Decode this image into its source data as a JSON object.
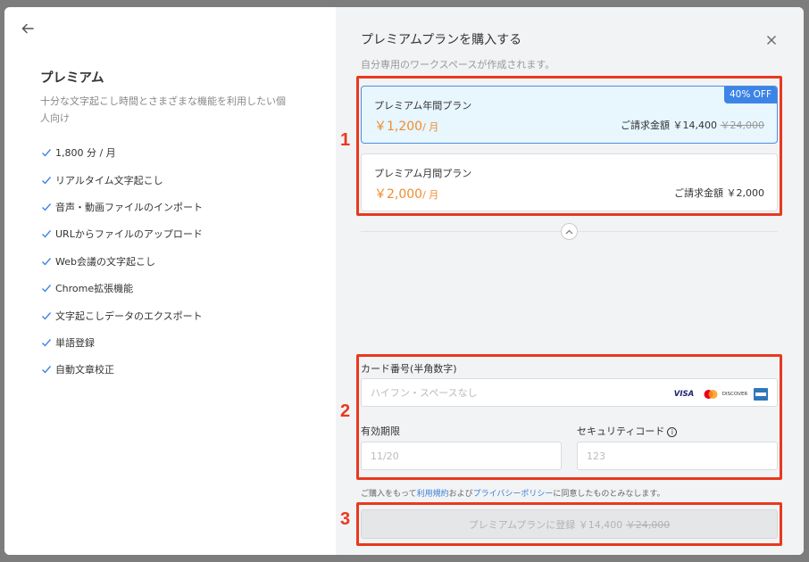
{
  "left": {
    "back_icon": "arrow-left-icon",
    "plan_title": "プレミアム",
    "plan_desc": "十分な文字起こし時間とさまざまな機能を利用したい個人向け",
    "features": [
      "1,800 分 / 月",
      "リアルタイム文字起こし",
      "音声・動画ファイルのインポート",
      "URLからファイルのアップロード",
      "Web会議の文字起こし",
      "Chrome拡張機能",
      "文字起こしデータのエクスポート",
      "単語登録",
      "自動文章校正"
    ]
  },
  "right": {
    "title": "プレミアムプランを購入する",
    "subtitle": "自分専用のワークスペースが作成されます。",
    "close_icon": "close-icon",
    "plans": [
      {
        "name": "プレミアム年間プラン",
        "price": "￥1,200",
        "per": "/ 月",
        "bill_label": "ご請求金額 ￥14,400",
        "bill_strike": "￥24,000",
        "badge": "40% OFF"
      },
      {
        "name": "プレミアム月間プラン",
        "price": "￥2,000",
        "per": "/ 月",
        "bill_label": "ご請求金額 ￥2,000"
      }
    ],
    "card_label": "カード番号(半角数字)",
    "card_placeholder": "ハイフン・スペースなし",
    "brands": [
      "VISA",
      "DISCOVER"
    ],
    "expiry_label": "有効期限",
    "expiry_placeholder": "11/20",
    "cvc_label": "セキュリティコード",
    "cvc_placeholder": "123",
    "terms_prefix": "ご購入をもって",
    "terms_link1": "利用規約",
    "terms_mid": "および",
    "terms_link2": "プライバシーポリシー",
    "terms_suffix": "に同意したものとみなします。",
    "submit_label": "プレミアムプランに登録 ￥14,400",
    "submit_strike": "￥24,000"
  },
  "annotations": [
    "1",
    "2",
    "3"
  ],
  "colors": {
    "accent": "#3c85e6",
    "price": "#f08c2d",
    "annotation": "#e8391f"
  }
}
